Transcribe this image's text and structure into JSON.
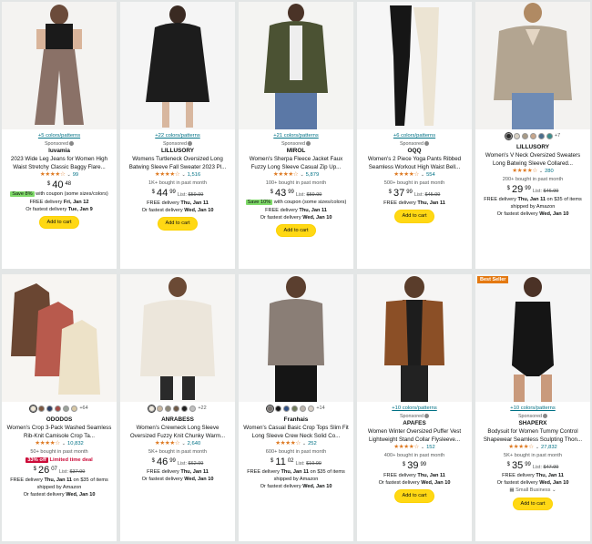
{
  "products": [
    {
      "colors_link": "+5 colors/patterns",
      "sponsored": "Sponsored",
      "brand": "luvamia",
      "title": "2023 Wide Leg Jeans for Women High Waist Stretchy Classic Baggy Flare...",
      "reviews": "99",
      "price_whole": "40",
      "price_frac": "48",
      "coupon_badge": "Save 8%",
      "coupon_text": "with coupon (some sizes/colors)",
      "delivery": "FREE delivery",
      "delivery_date": "Fri, Jan 12",
      "fastest": "Or fastest delivery",
      "fastest_date": "Tue, Jan 9",
      "atc": "Add to cart"
    },
    {
      "colors_link": "+22 colors/patterns",
      "sponsored": "Sponsored",
      "brand": "LILLUSORY",
      "title": "Womens Turtleneck Oversized Long Batwing Sleeve Fall Sweater 2023 Pl...",
      "reviews": "1,516",
      "bought": "1K+ bought in past month",
      "price_whole": "44",
      "price_frac": "99",
      "list_label": "List:",
      "list_price": "$59.99",
      "delivery": "FREE delivery",
      "delivery_date": "Thu, Jan 11",
      "fastest": "Or fastest delivery",
      "fastest_date": "Wed, Jan 10",
      "atc": "Add to cart"
    },
    {
      "colors_link": "+21 colors/patterns",
      "sponsored": "Sponsored",
      "brand": "MIROL",
      "title": "Women's Sherpa Fleece Jacket Faux Fuzzy Long Sleeve Casual Zip Up...",
      "reviews": "5,879",
      "bought": "100+ bought in past month",
      "price_whole": "43",
      "price_frac": "99",
      "list_label": "List:",
      "list_price": "$59.99",
      "coupon_badge": "Save 10%",
      "coupon_text": "with coupon (some sizes/colors)",
      "delivery": "FREE delivery",
      "delivery_date": "Thu, Jan 11",
      "fastest": "Or fastest delivery",
      "fastest_date": "Wed, Jan 10",
      "atc": "Add to cart"
    },
    {
      "colors_link": "+6 colors/patterns",
      "sponsored": "Sponsored",
      "brand": "OQQ",
      "title": "Women's 2 Piece Yoga Pants Ribbed Seamless Workout High Waist Bell...",
      "reviews": "554",
      "bought": "500+ bought in past month",
      "price_whole": "37",
      "price_frac": "99",
      "list_label": "List:",
      "list_price": "$45.99",
      "delivery": "FREE delivery",
      "delivery_date": "Thu, Jan 11",
      "atc": "Add to cart"
    },
    {
      "swatch_more": "+7",
      "brand": "LILLUSORY",
      "title": "Women's V Neck Oversized Sweaters Long Batwing Sleeve Collared...",
      "reviews": "280",
      "bought": "200+ bought in past month",
      "price_whole": "29",
      "price_frac": "99",
      "list_label": "List:",
      "list_price": "$46.99",
      "delivery": "FREE delivery",
      "delivery_date": "Thu, Jan 11",
      "delivery_suffix": "on $35 of items shipped by Amazon",
      "fastest": "Or fastest delivery",
      "fastest_date": "Wed, Jan 10"
    },
    {
      "swatch_more": "+64",
      "brand": "ODODOS",
      "title": "Women's Crop 3-Pack Washed Seamless Rib-Knit Camisole Crop Ta...",
      "reviews": "10,832",
      "bought": "50+ bought in past month",
      "deal_badge": "33% off",
      "deal_text": "Limited time deal",
      "price_whole": "26",
      "price_frac": "07",
      "list_label": "List:",
      "list_price": "$37.99",
      "delivery": "FREE delivery",
      "delivery_date": "Thu, Jan 11",
      "delivery_suffix": "on $35 of items shipped by Amazon",
      "fastest": "Or fastest delivery",
      "fastest_date": "Wed, Jan 10"
    },
    {
      "swatch_more": "+22",
      "brand": "ANRABESS",
      "title": "Women's Crewneck Long Sleeve Oversized Fuzzy Knit Chunky Warm...",
      "reviews": "2,640",
      "bought": "5K+ bought in past month",
      "price_whole": "46",
      "price_frac": "99",
      "list_label": "List:",
      "list_price": "$62.99",
      "delivery": "FREE delivery",
      "delivery_date": "Thu, Jan 11",
      "fastest": "Or fastest delivery",
      "fastest_date": "Wed, Jan 10"
    },
    {
      "swatch_more": "+14",
      "brand": "Franhais",
      "title": "Women's Casual Basic Crop Tops Slim Fit Long Sleeve Crew Neck Solid Co...",
      "reviews": "252",
      "bought": "600+ bought in past month",
      "price_whole": "11",
      "price_frac": "02",
      "list_label": "List:",
      "list_price": "$19.99",
      "delivery": "FREE delivery",
      "delivery_date": "Thu, Jan 11",
      "delivery_suffix": "on $35 of items shipped by Amazon",
      "fastest": "Or fastest delivery",
      "fastest_date": "Wed, Jan 10"
    },
    {
      "colors_link": "+10 colors/patterns",
      "sponsored": "Sponsored",
      "brand": "APAFES",
      "title": "Women Winter Oversized Puffer Vest Lightweight Stand Collar Flysleeve...",
      "reviews": "152",
      "bought": "400+ bought in past month",
      "price_whole": "39",
      "price_frac": "99",
      "delivery": "FREE delivery",
      "delivery_date": "Thu, Jan 11",
      "fastest": "Or fastest delivery",
      "fastest_date": "Wed, Jan 10",
      "atc": "Add to cart"
    },
    {
      "best_seller": "Best Seller",
      "colors_link": "+10 colors/patterns",
      "sponsored": "Sponsored",
      "brand": "SHAPERX",
      "title": "Bodysuit for Women Tummy Control Shapewear Seamless Sculpting Thon...",
      "reviews": "27,832",
      "bought": "5K+ bought in past month",
      "price_whole": "35",
      "price_frac": "99",
      "list_label": "List:",
      "list_price": "$47.99",
      "delivery": "FREE delivery",
      "delivery_date": "Thu, Jan 11",
      "fastest": "Or fastest delivery",
      "fastest_date": "Wed, Jan 10",
      "small_business": "Small Business",
      "atc": "Add to cart"
    }
  ],
  "symbols": {
    "dollar": "$",
    "stars": "★★★★☆",
    "caret": "⌄"
  },
  "colors": {
    "star": "#de7921",
    "link": "#007185",
    "button": "#ffd814",
    "deal": "#cc0c39",
    "coupon": "#7fda69",
    "best_seller": "#e47911"
  }
}
